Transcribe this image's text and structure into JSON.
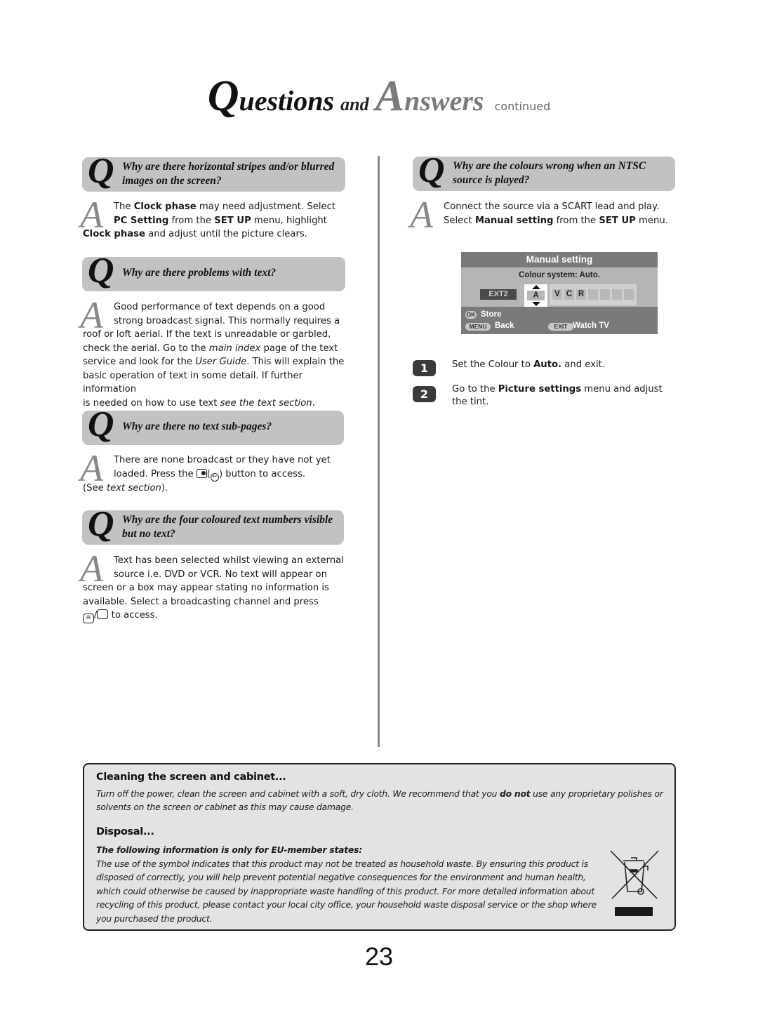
{
  "title": {
    "q_cap": "Q",
    "q_rest": "uestions",
    "and": "and",
    "a_cap": "A",
    "a_rest": "nswers",
    "continued": "continued"
  },
  "left": [
    {
      "question": "Why are there horizontal stripes and/or blurred images on the screen?",
      "answer": {
        "l1_a": "The ",
        "l1_b": "Clock phase",
        "l1_c": " may need adjustment. Select",
        "l2_a": "PC Setting",
        "l2_b": " from the ",
        "l2_c": "SET UP",
        "l2_d": " menu, highlight",
        "l3_a": "Clock phase",
        "l3_b": " and adjust until the picture clears."
      }
    },
    {
      "question": "Why are there problems with text?",
      "answer": {
        "l1": "Good performance of text depends on a good",
        "l2": "strong broadcast signal. This normally requires a",
        "l3": "roof or loft aerial. If the text is unreadable or garbled,",
        "l4_a": "check the aerial. Go to the ",
        "l4_b": "main index",
        "l4_c": " page of the text",
        "l5_a": "service and look for the ",
        "l5_b": "User Guide",
        "l5_c": ". This will explain the",
        "l6": "basic operation of text in some detail. If further information",
        "l7_a": "is needed on how to use text ",
        "l7_b": "see the text section",
        "l7_c": "."
      }
    },
    {
      "question": "Why are there no text sub-pages?",
      "answer": {
        "l1": "There are none broadcast or they have not yet",
        "l2_a": "loaded. Press the ",
        "l2_b": "(",
        "l2_c": ") button to access.",
        "l3_a": "(See ",
        "l3_b": "text section",
        "l3_c": ")."
      }
    },
    {
      "question": "Why are the four coloured text numbers visible but no text?",
      "answer": {
        "l1": "Text has been selected whilst viewing an external",
        "l2": "source i.e. DVD or VCR. No text will appear on",
        "l3": "screen or a box may appear stating no information is",
        "l4": "available. Select a broadcasting channel and press",
        "l5_sep": "/",
        "l5": " to access."
      }
    }
  ],
  "right": {
    "question": "Why are the colours wrong when an NTSC source is played?",
    "answer": {
      "l1": "Connect the source via a SCART lead and play.",
      "l2_a": "Select ",
      "l2_b": "Manual setting",
      "l2_c": " from the ",
      "l2_d": "SET UP",
      "l2_e": " menu."
    },
    "osd": {
      "header": "Manual setting",
      "colour_system": "Colour system: Auto.",
      "source": "EXT2",
      "selected_char": "A",
      "chars": [
        "V",
        "C",
        "R",
        "",
        "",
        "",
        ""
      ],
      "ok_key": "OK",
      "ok_label": "Store",
      "menu_key": "MENU",
      "menu_label": "Back",
      "exit_key": "EXIT",
      "exit_label": "Watch TV"
    },
    "steps": [
      {
        "num": "1",
        "a": "Set the Colour to ",
        "b": "Auto.",
        "c": " and exit."
      },
      {
        "num": "2",
        "a": "Go to the ",
        "b": "Picture settings",
        "c": " menu and adjust",
        "d": "the tint."
      }
    ]
  },
  "bottom": {
    "cleaning_title": "Cleaning the screen and cabinet...",
    "cleaning_l1_a": "Turn off the power, clean the screen and cabinet with a soft, dry cloth. We recommend that you ",
    "cleaning_l1_b": "do not",
    "cleaning_l1_c": " use any proprietary polishes or",
    "cleaning_l2": "solvents on the screen or cabinet as this may cause damage.",
    "disposal_title": "Disposal...",
    "disposal_sub": "The following information is only for EU-member states:",
    "disposal_lines": [
      "The use of the symbol indicates that this product may not be treated as household waste. By ensuring this product is",
      "disposed of correctly, you will help prevent potential negative consequences for the environment and human health,",
      "which could otherwise be caused by inappropriate waste handling of this product. For more detailed information about",
      "recycling of this product, please contact your local city office, your household waste disposal service or the shop where",
      "you purchased the product."
    ],
    "weee_icon": "crossed-out-wheelie-bin-icon"
  },
  "page_number": "23"
}
